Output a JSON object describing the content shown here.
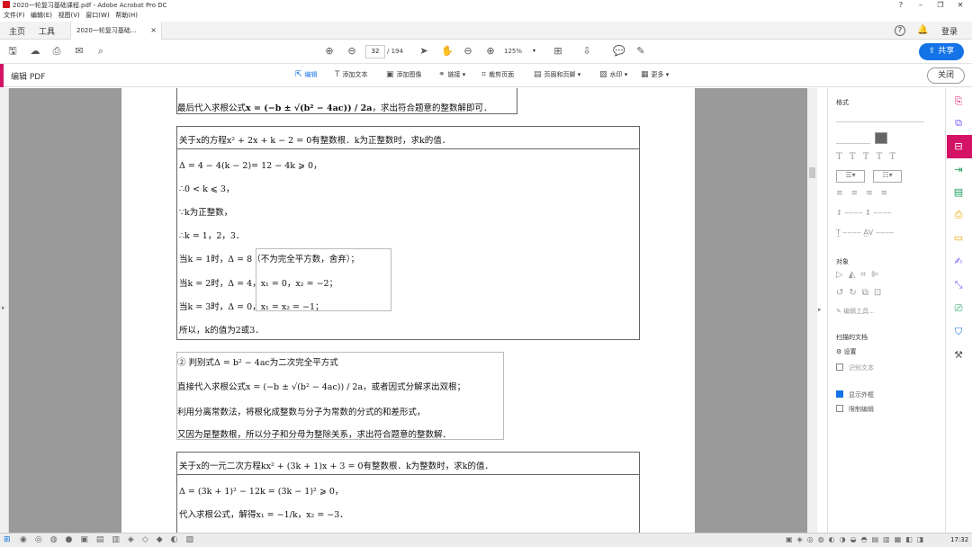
{
  "window": {
    "title": "2020一轮复习基础课程.pdf - Adobe Acrobat Pro DC"
  },
  "menu": [
    "文件(F)",
    "编辑(E)",
    "视图(V)",
    "窗口(W)",
    "帮助(H)"
  ],
  "tabs": {
    "home": "主页",
    "tools": "工具",
    "doc": "2020一轮复习基础..."
  },
  "header": {
    "login": "登录",
    "share": "共享"
  },
  "toolbar": {
    "page_current": "32",
    "page_total": "/ 194",
    "zoom": "125%"
  },
  "editbar": {
    "label": "编辑 PDF",
    "edit": "编辑",
    "add_text": "添加文本",
    "add_image": "添加图像",
    "link": "链接",
    "crop": "裁剪页面",
    "header_footer": "页眉和页脚",
    "watermark": "水印",
    "more": "更多",
    "close": "关闭"
  },
  "doc": {
    "top_line": {
      "pre": "最后代入求根公式",
      "formula": "x = (−b ± √(b² − 4ac)) / 2a",
      "post": "，求出符合题意的整数解即可．"
    },
    "ex1": {
      "title": "关于x的方程x² + 2x + k − 2 = 0有整数根．k为正整数时，求k的值．",
      "lines": [
        "Δ = 4 − 4(k − 2)= 12 − 4k ⩾ 0，",
        "∴0 < k ⩽ 3，",
        "∵k为正整数，",
        "∴k = 1，2，3．",
        "当k = 1时，Δ = 8（不为完全平方数，舍弃）；",
        "当k = 2时，Δ = 4，x₁ = 0，x₂ = −2；",
        "当k = 3时，Δ = 0，x₁ = x₂ = −1；",
        "所以，k的值为2或3．"
      ]
    },
    "method2": {
      "lines": [
        "② 判别式Δ = b² − 4ac为二次完全平方式",
        "直接代入求根公式x = (−b ± √(b² − 4ac)) / 2a，或者因式分解求出双根；",
        "利用分离常数法，将根化成整数与分子为常数的分式的和差形式，",
        "又因为是整数根，所以分子和分母为整除关系，求出符合题意的整数解．"
      ]
    },
    "ex2": {
      "title": "关于x的一元二次方程kx² + (3k + 1)x + 3 = 0有整数根．k为整数时，求k的值．",
      "lines": [
        "Δ = (3k + 1)² − 12k = (3k − 1)² ⩾ 0，",
        "代入求根公式，解得x₁ = −1/k，x₂ = −3．"
      ]
    }
  },
  "right_panel": {
    "format": "格式",
    "objects": "对象",
    "edit_tools": "编辑工具...",
    "scanned": "扫描的文档",
    "settings": "设置",
    "recognize": "识别文本",
    "show_outline": "显示外框",
    "restrict_edit": "限制编辑"
  },
  "taskbar": {
    "time": "17:32"
  },
  "colors": {
    "accent": "#d41367",
    "share": "#1473e6",
    "page_bg": "#9a9a9a"
  }
}
